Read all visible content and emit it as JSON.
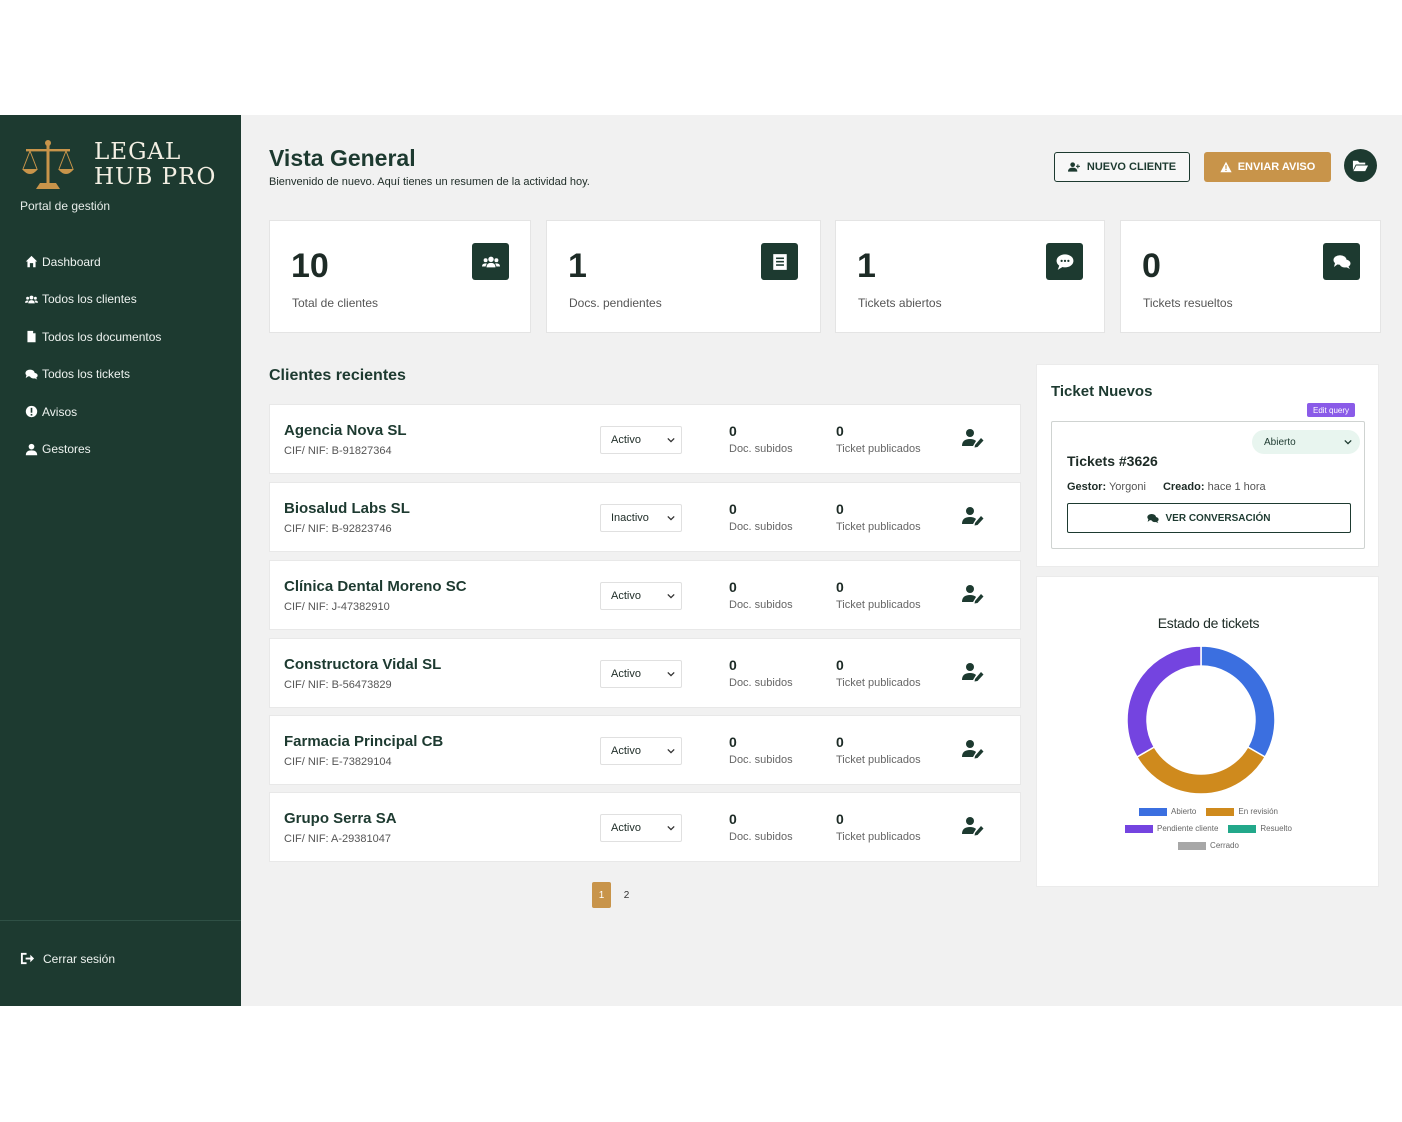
{
  "sidebar": {
    "brand_line1": "LEGAL",
    "brand_line2": "HUB PRO",
    "subtitle": "Portal de gestión",
    "items": [
      {
        "label": "Dashboard",
        "icon": "home-icon"
      },
      {
        "label": "Todos los clientes",
        "icon": "users-icon"
      },
      {
        "label": "Todos los documentos",
        "icon": "file-icon"
      },
      {
        "label": "Todos los tickets",
        "icon": "comments-icon"
      },
      {
        "label": "Avisos",
        "icon": "alert-icon"
      },
      {
        "label": "Gestores",
        "icon": "user-icon"
      }
    ],
    "logout": "Cerrar sesión"
  },
  "header": {
    "title": "Vista General",
    "subtitle": "Bienvenido de nuevo. Aquí tienes un resumen de la actividad hoy.",
    "new_client": "NUEVO CLIENTE",
    "send_notice": "ENVIAR AVISO"
  },
  "stats": [
    {
      "value": "10",
      "label": "Total de clientes",
      "icon": "users-icon"
    },
    {
      "value": "1",
      "label": "Docs. pendientes",
      "icon": "document-icon"
    },
    {
      "value": "1",
      "label": "Tickets abiertos",
      "icon": "comment-icon"
    },
    {
      "value": "0",
      "label": "Tickets resueltos",
      "icon": "comments-icon"
    }
  ],
  "recent_clients": {
    "title": "Clientes recientes",
    "docs_label": "Doc. subidos",
    "tickets_label": "Ticket publicados",
    "rows": [
      {
        "name": "Agencia Nova SL",
        "nif": "CIF/ NIF: B-91827364",
        "status": "Activo",
        "docs": "0",
        "tickets": "0"
      },
      {
        "name": "Biosalud Labs SL",
        "nif": "CIF/ NIF: B-92823746",
        "status": "Inactivo",
        "docs": "0",
        "tickets": "0"
      },
      {
        "name": "Clínica Dental Moreno SC",
        "nif": "CIF/ NIF: J-47382910",
        "status": "Activo",
        "docs": "0",
        "tickets": "0"
      },
      {
        "name": "Constructora Vidal SL",
        "nif": "CIF/ NIF: B-56473829",
        "status": "Activo",
        "docs": "0",
        "tickets": "0"
      },
      {
        "name": "Farmacia Principal CB",
        "nif": "CIF/ NIF: E-73829104",
        "status": "Activo",
        "docs": "0",
        "tickets": "0"
      },
      {
        "name": "Grupo Serra SA",
        "nif": "CIF/ NIF: A-29381047",
        "status": "Activo",
        "docs": "0",
        "tickets": "0"
      }
    ],
    "pages": [
      "1",
      "2"
    ]
  },
  "new_tickets": {
    "title": "Ticket Nuevos",
    "edit_badge": "Edit query",
    "ticket": {
      "status": "Abierto",
      "number": "Tickets #3626",
      "manager_label": "Gestor:",
      "manager": "Yorgoni",
      "created_label": "Creado:",
      "created": "hace 1 hora",
      "button": "VER CONVERSACIÓN"
    }
  },
  "chart_data": {
    "type": "pie",
    "title": "Estado de tickets",
    "categories": [
      "Abierto",
      "En revisión",
      "Pendiente cliente",
      "Resuelto",
      "Cerrado"
    ],
    "values": [
      1,
      1,
      1,
      0,
      0
    ],
    "colors": [
      "#3b6fe0",
      "#cf8a1d",
      "#7444e0",
      "#22a88a",
      "#a7a7a7"
    ],
    "legend_position": "bottom"
  },
  "colors": {
    "sidebar": "#1d3a30",
    "accent": "#c8944a",
    "badge": "#8a5be8"
  }
}
